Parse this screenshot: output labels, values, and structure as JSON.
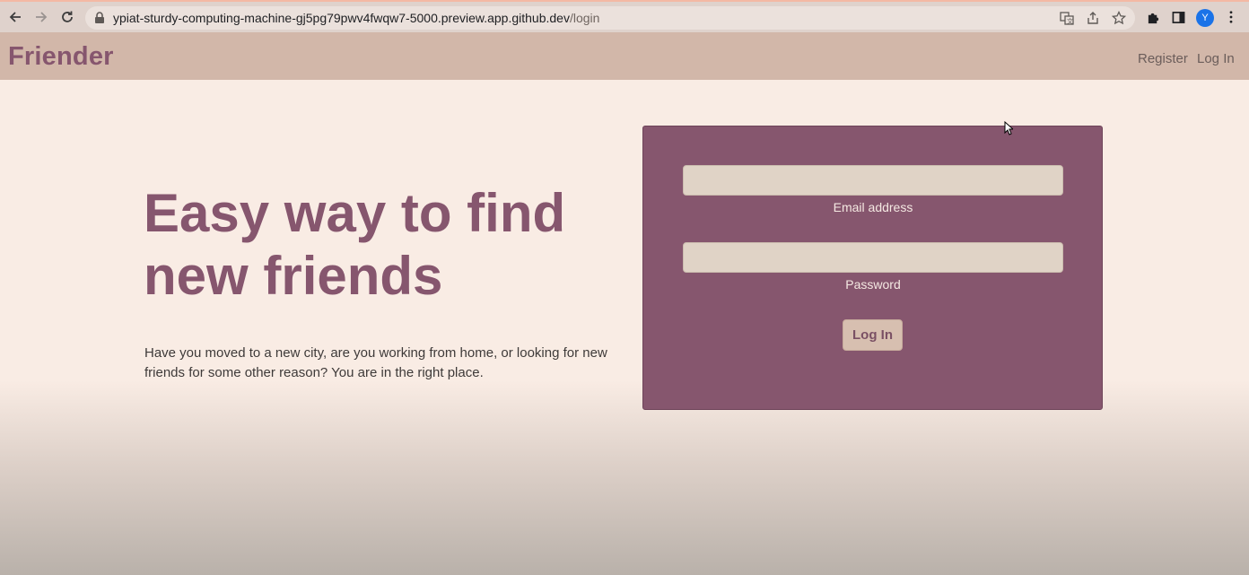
{
  "browser": {
    "url_host": "ypiat-sturdy-computing-machine-gj5pg79pwv4fwqw7-5000.preview.app.github.dev",
    "url_path": "/login",
    "profile_initial": "Y"
  },
  "navbar": {
    "brand": "Friender",
    "links": [
      {
        "label": "Register"
      },
      {
        "label": "Log In"
      }
    ]
  },
  "hero": {
    "title": "Easy way to find new friends",
    "text": "Have you moved to a new city, are you working from home, or looking for new friends for some other reason? You are in the right place."
  },
  "login_form": {
    "email_value": "",
    "email_label": "Email address",
    "password_value": "",
    "password_label": "Password",
    "submit_label": "Log In"
  },
  "colors": {
    "brand": "#86566e",
    "navbar_bg": "#d2b7a9",
    "page_bg": "#f9ece4",
    "input_bg": "#e0d3c6",
    "button_bg": "#d7bfb0"
  }
}
